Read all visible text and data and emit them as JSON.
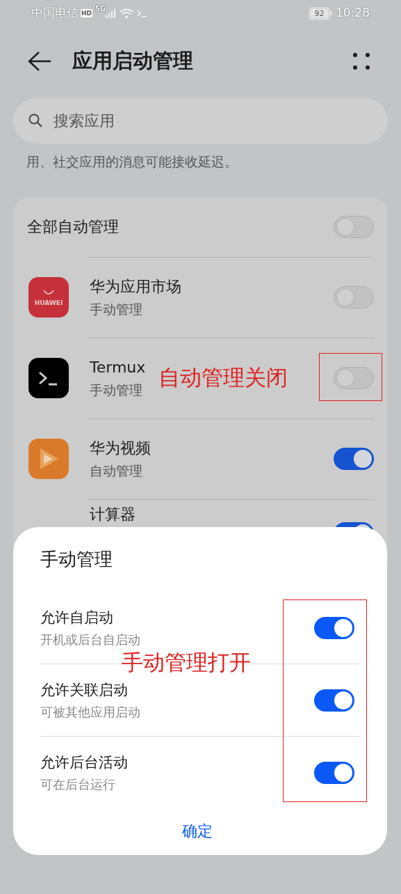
{
  "status_bar": {
    "carrier": "中国电信",
    "hd": "HD",
    "network": "5G",
    "battery": "92",
    "time": "10:28"
  },
  "header": {
    "title": "应用启动管理"
  },
  "search": {
    "placeholder": "搜索应用"
  },
  "notice": "用、社交应用的消息可能接收延迟。",
  "all_auto": {
    "label": "全部自动管理",
    "on": false
  },
  "apps": [
    {
      "kind": "appgallery",
      "icon_text": "HUAWEI",
      "name": "华为应用市场",
      "status": "手动管理",
      "on": false
    },
    {
      "kind": "terminal",
      "name": "Termux",
      "status": "手动管理",
      "on": false
    },
    {
      "kind": "video",
      "name": "华为视频",
      "status": "自动管理",
      "on": true
    },
    {
      "kind": "calculator",
      "name": "计算器",
      "on": true
    }
  ],
  "sheet": {
    "title": "手动管理",
    "options": [
      {
        "label": "允许自启动",
        "description": "开机或后台自启动",
        "on": true
      },
      {
        "label": "允许关联启动",
        "description": "可被其他应用启动",
        "on": true
      },
      {
        "label": "允许后台活动",
        "description": "可在后台运行",
        "on": true
      }
    ],
    "confirm": "确定"
  },
  "annotations": [
    {
      "kind": "app_toggle",
      "text": "自动管理关闭",
      "color": "#e02020"
    },
    {
      "kind": "sheet_toggles",
      "text": "手动管理打开",
      "color": "#e02020"
    }
  ]
}
